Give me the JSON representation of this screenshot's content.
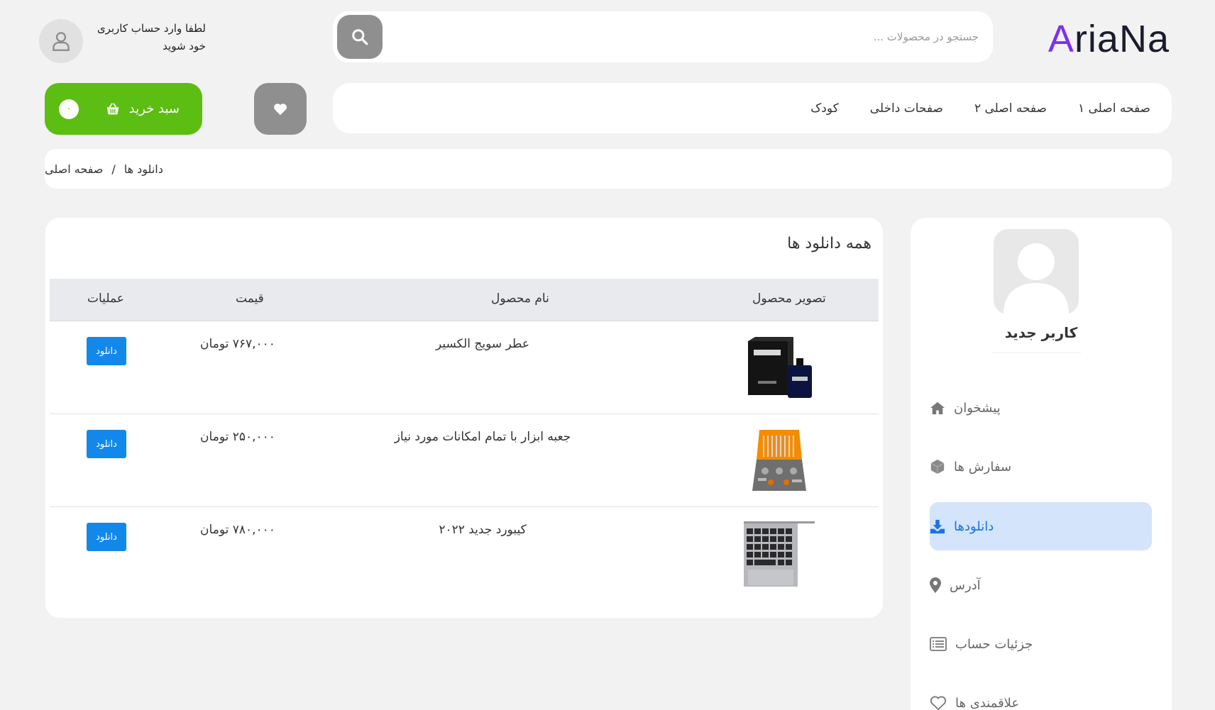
{
  "header": {
    "logo_first": "A",
    "logo_rest": "riaNa",
    "search_placeholder": "جستجو در محصولات ...",
    "login_text": "لطفا وارد حساب کاربری خود شوید"
  },
  "nav": {
    "items": [
      "صفحه اصلی ۱",
      "صفحه اصلی ۲",
      "صفحات داخلی",
      "کودک"
    ]
  },
  "cart": {
    "label": "سبد خرید",
    "count": "۰"
  },
  "breadcrumb": {
    "home": "صفحه اصلی",
    "separator": "/",
    "current": "دانلود ها"
  },
  "sidebar": {
    "user_name": "کاربر جدید",
    "items": [
      {
        "label": "پیشخوان",
        "icon": "home-icon"
      },
      {
        "label": "سفارش ها",
        "icon": "box-icon"
      },
      {
        "label": "دانلودها",
        "icon": "download-icon",
        "active": true
      },
      {
        "label": "آدرس",
        "icon": "map-pin-icon"
      },
      {
        "label": "جزئیات حساب",
        "icon": "list-icon"
      },
      {
        "label": "علاقمندی ها",
        "icon": "heart-icon"
      }
    ]
  },
  "downloads": {
    "title": "همه دانلود ها",
    "columns": [
      "تصویر محصول",
      "نام محصول",
      "قیمت",
      "عملیات"
    ],
    "rows": [
      {
        "name": "عطر سویج الکسیر",
        "price": "۷۶۷,۰۰۰ تومان",
        "action": "دانلود",
        "image": "perfume"
      },
      {
        "name": "جعبه ابزار با تمام امکانات مورد نیاز",
        "price": "۲۵۰,۰۰۰ تومان",
        "action": "دانلود",
        "image": "toolbox"
      },
      {
        "name": "کیبورد جدید ۲۰۲۲",
        "price": "۷۸۰,۰۰۰ تومان",
        "action": "دانلود",
        "image": "keyboard"
      }
    ]
  },
  "colors": {
    "accent_green": "#5cbd12",
    "accent_blue": "#1289ea",
    "logo_purple": "#7b2ff7",
    "active_bg": "#d3e4fb"
  }
}
